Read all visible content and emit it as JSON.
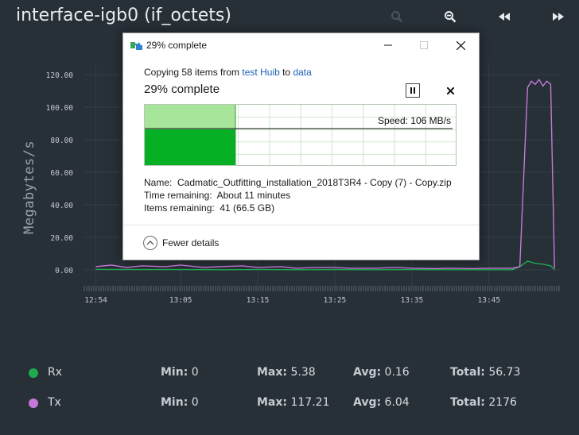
{
  "panel": {
    "title": "interface-igb0 (if_octets)",
    "header_buttons": [
      "zoom-in-icon",
      "zoom-out-icon",
      "rewind-icon",
      "fast-forward-icon"
    ]
  },
  "chart_data": {
    "type": "line",
    "ylabel": "Megabytes/s",
    "xlabel": "",
    "ylim": [
      0,
      125
    ],
    "y_ticks": [
      "0.00",
      "20.00",
      "40.00",
      "60.00",
      "80.00",
      "100.00",
      "120.00"
    ],
    "x_ticks": [
      "12:54",
      "13:05",
      "13:15",
      "13:25",
      "13:35",
      "13:45"
    ],
    "grid": true,
    "legend_position": "bottom",
    "series": [
      {
        "name": "Rx",
        "color": "#1faa4f",
        "x": [
          "12:54",
          "13:00",
          "13:05",
          "13:10",
          "13:15",
          "13:20",
          "13:25",
          "13:30",
          "13:35",
          "13:40",
          "13:45",
          "13:48",
          "13:49",
          "13:50",
          "13:51",
          "13:52",
          "13:53",
          "13:53.5"
        ],
        "values": [
          0.3,
          0.2,
          0.2,
          0.1,
          0.2,
          0.1,
          0.2,
          0.1,
          0.2,
          0.1,
          0.1,
          0.1,
          2.0,
          5.4,
          4.0,
          3.5,
          2.5,
          0.2
        ]
      },
      {
        "name": "Tx",
        "color": "#c678d8",
        "x": [
          "12:54",
          "12:56",
          "12:58",
          "13:00",
          "13:03",
          "13:05",
          "13:08",
          "13:10",
          "13:13",
          "13:15",
          "13:18",
          "13:20",
          "13:23",
          "13:25",
          "13:27",
          "13:30",
          "13:33",
          "13:35",
          "13:38",
          "13:40",
          "13:43",
          "13:45",
          "13:48",
          "13:49",
          "13:50",
          "13:50.5",
          "13:51",
          "13:51.5",
          "13:52",
          "13:52.5",
          "13:53",
          "13:53.5"
        ],
        "values": [
          2.0,
          3.0,
          1.5,
          2.5,
          2.0,
          3.0,
          1.5,
          2.0,
          2.5,
          1.5,
          2.0,
          1.0,
          1.5,
          1.5,
          1.0,
          1.0,
          1.5,
          1.0,
          0.8,
          1.0,
          0.8,
          1.0,
          1.0,
          2.0,
          112.0,
          116.0,
          114.0,
          117.0,
          113.0,
          116.0,
          114.0,
          1.0
        ]
      }
    ]
  },
  "legend": {
    "rows": [
      {
        "name": "Rx",
        "color": "#1faa4f",
        "min_label": "Min:",
        "min": "0",
        "max_label": "Max:",
        "max": "5.38",
        "avg_label": "Avg:",
        "avg": "0.16",
        "total_label": "Total:",
        "total": "56.73"
      },
      {
        "name": "Tx",
        "color": "#c678d8",
        "min_label": "Min:",
        "min": "0",
        "max_label": "Max:",
        "max": "117.21",
        "avg_label": "Avg:",
        "avg": "6.04",
        "total_label": "Total:",
        "total": "2176"
      }
    ]
  },
  "copy_dialog": {
    "title": "29% complete",
    "copy_prefix": "Copying 58 items from ",
    "source": "test Huib",
    "copy_mid": " to ",
    "destination": "data",
    "percent_text": "29% complete",
    "progress": 0.29,
    "speed_label": "Speed: 106 MB/s",
    "name_label": "Name:",
    "name_value": "Cadmatic_Outfitting_installation_2018T3R4 - Copy (7) - Copy.zip",
    "time_label": "Time remaining:",
    "time_value": "About 11 minutes",
    "items_label": "Items remaining:",
    "items_value": "41 (66.5 GB)",
    "fewer_details": "Fewer details",
    "accent_color": "#06b025",
    "fill_color": "#a6e59a"
  }
}
